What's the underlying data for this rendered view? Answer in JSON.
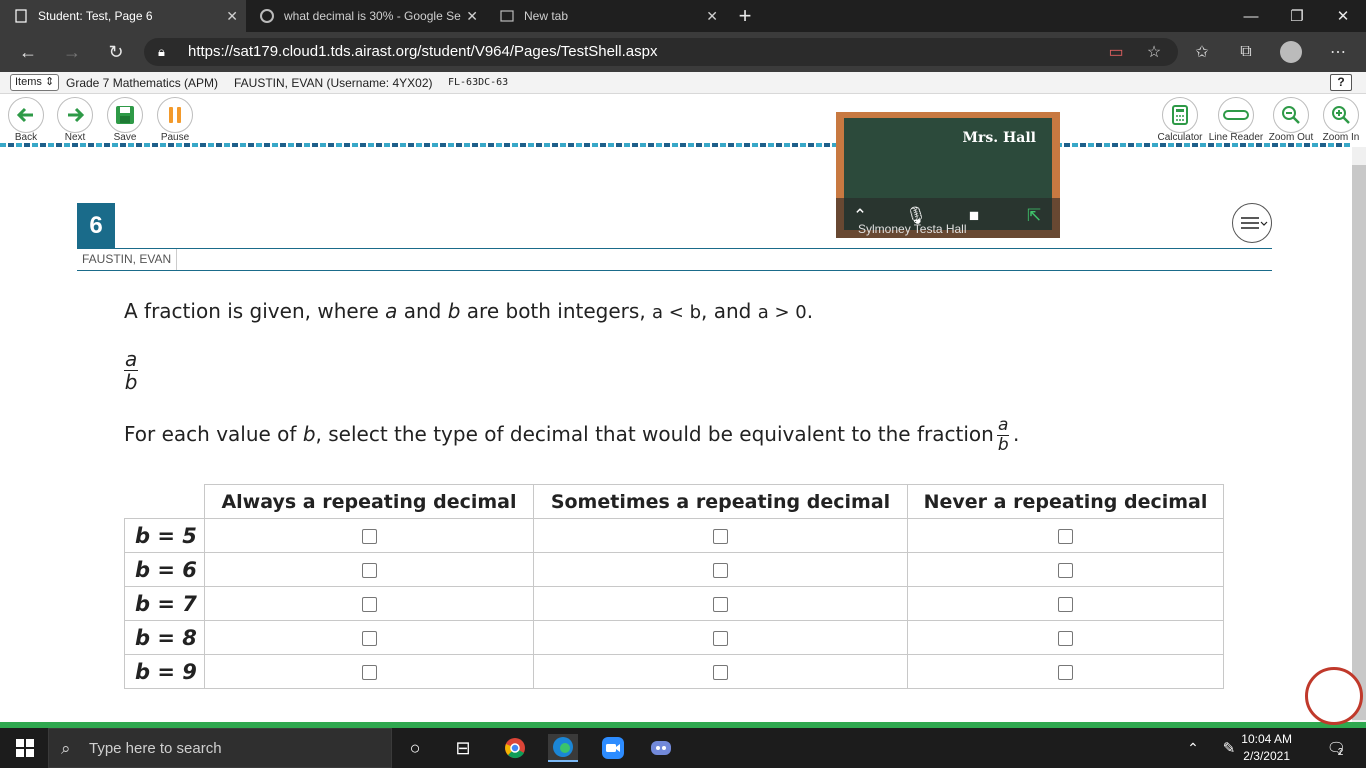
{
  "browser": {
    "tabs": [
      {
        "title": "Student: Test, Page 6",
        "active": true
      },
      {
        "title": "what decimal is 30% - Google Se",
        "active": false
      },
      {
        "title": "New tab",
        "active": false
      }
    ],
    "url": "https://sat179.cloud1.tds.airast.org/student/V964/Pages/TestShell.aspx"
  },
  "header": {
    "items_label": "Items",
    "test_name": "Grade 7 Mathematics (APM)",
    "student": "FAUSTIN, EVAN (Username: 4YX02)",
    "session": "FL-63DC-63",
    "help": "?"
  },
  "toolbar": {
    "back": "Back",
    "next": "Next",
    "save": "Save",
    "pause": "Pause",
    "calculator": "Calculator",
    "line_reader": "Line Reader",
    "zoom_out": "Zoom Out",
    "zoom_in": "Zoom In"
  },
  "video": {
    "board_text": "Mrs. Hall",
    "participant": "Sylmoney Testa Hall"
  },
  "question": {
    "number": "6",
    "student_name": "FAUSTIN, EVAN",
    "stem_part1": "A fraction is given, where ",
    "var_a": "a",
    "stem_and": " and ",
    "var_b": "b",
    "stem_part2": " are both integers, ",
    "cond1": "a < b",
    "stem_part3": ", and ",
    "cond2": "a > 0",
    "stem_end": ".",
    "fraction_num": "a",
    "fraction_den": "b",
    "instr_part1": "For each value of ",
    "instr_var": "b",
    "instr_part2": ", select the type of decimal that would be equivalent to the fraction",
    "instr_end": ".",
    "columns": [
      "Always a repeating decimal",
      "Sometimes a repeating decimal",
      "Never a repeating decimal"
    ],
    "rows": [
      "b = 5",
      "b = 6",
      "b = 7",
      "b = 8",
      "b = 9"
    ]
  },
  "taskbar": {
    "search_placeholder": "Type here to search",
    "time": "10:04 AM",
    "date": "2/3/2021",
    "notifications": "2"
  }
}
